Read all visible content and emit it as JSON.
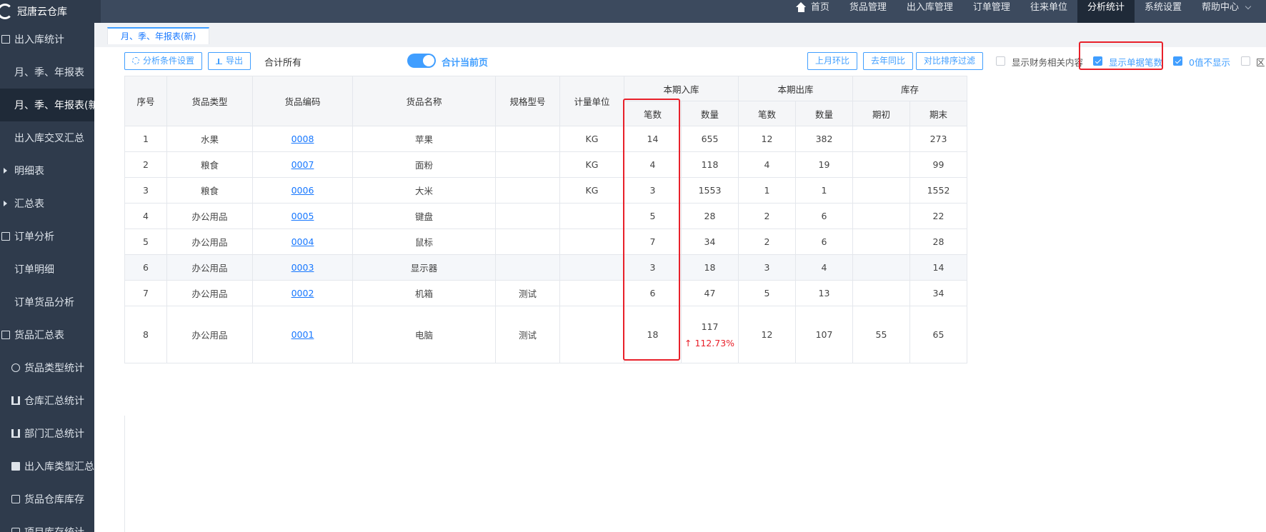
{
  "app": {
    "name": "冠唐云仓库"
  },
  "nav": {
    "items": [
      "首页",
      "货品管理",
      "出入库管理",
      "订单管理",
      "往来单位",
      "分析统计",
      "系统设置",
      "帮助中心"
    ],
    "active": "分析统计"
  },
  "sidebar": {
    "items": [
      {
        "label": "出入库统计",
        "icon": "doc-icon"
      },
      {
        "label": "月、季、年报表"
      },
      {
        "label": "月、季、年报表(新)",
        "selected": true
      },
      {
        "label": "出入库交叉汇总"
      },
      {
        "label": "明细表",
        "icon": "caret-right-icon"
      },
      {
        "label": "汇总表",
        "icon": "caret-right-icon"
      },
      {
        "label": "订单分析",
        "icon": "doc-icon"
      },
      {
        "label": "订单明细"
      },
      {
        "label": "订单货品分析"
      },
      {
        "label": "货品汇总表",
        "icon": "doc-icon"
      },
      {
        "label": "货品类型统计",
        "icon": "clock-icon"
      },
      {
        "label": "仓库汇总统计",
        "icon": "bar-chart-icon"
      },
      {
        "label": "部门汇总统计",
        "icon": "bar-chart-icon"
      },
      {
        "label": "出入库类型汇总",
        "icon": "picture-icon"
      },
      {
        "label": "货品仓库库存",
        "icon": "box-icon"
      },
      {
        "label": "项目库存统计",
        "icon": "box-icon"
      }
    ]
  },
  "tab": {
    "label": "月、季、年报表(新)"
  },
  "toolbar": {
    "settings_label": "分析条件设置",
    "export_label": "导出",
    "sum_all_label": "合计所有",
    "sum_page_label": "合计当前页",
    "mom_label": "上月环比",
    "yoy_label": "去年同比",
    "filter_label": "对比排序过滤",
    "options": [
      {
        "label": "显示财务相关内容",
        "checked": false
      },
      {
        "label": "显示单据笔数",
        "checked": true
      },
      {
        "label": "0值不显示",
        "checked": true
      },
      {
        "label": "区",
        "checked": false
      }
    ]
  },
  "table": {
    "headers": {
      "index": "序号",
      "type": "货品类型",
      "code": "货品编码",
      "name": "货品名称",
      "spec": "规格型号",
      "unit": "计量单位",
      "in_group": "本期入库",
      "out_group": "本期出库",
      "stock_group": "库存",
      "count": "笔数",
      "qty": "数量",
      "begin": "期初",
      "end": "期末"
    },
    "rows": [
      {
        "index": "1",
        "type": "水果",
        "code": "0008",
        "name": "苹果",
        "spec": "",
        "unit": "KG",
        "in_count": "14",
        "in_qty": "655",
        "in_pct": "",
        "out_count": "12",
        "out_qty": "382",
        "begin": "",
        "end": "273"
      },
      {
        "index": "2",
        "type": "粮食",
        "code": "0007",
        "name": "面粉",
        "spec": "",
        "unit": "KG",
        "in_count": "4",
        "in_qty": "118",
        "in_pct": "",
        "out_count": "4",
        "out_qty": "19",
        "begin": "",
        "end": "99"
      },
      {
        "index": "3",
        "type": "粮食",
        "code": "0006",
        "name": "大米",
        "spec": "",
        "unit": "KG",
        "in_count": "3",
        "in_qty": "1553",
        "in_pct": "",
        "out_count": "1",
        "out_qty": "1",
        "begin": "",
        "end": "1552"
      },
      {
        "index": "4",
        "type": "办公用品",
        "code": "0005",
        "name": "键盘",
        "spec": "",
        "unit": "",
        "in_count": "5",
        "in_qty": "28",
        "in_pct": "",
        "out_count": "2",
        "out_qty": "6",
        "begin": "",
        "end": "22"
      },
      {
        "index": "5",
        "type": "办公用品",
        "code": "0004",
        "name": "鼠标",
        "spec": "",
        "unit": "",
        "in_count": "7",
        "in_qty": "34",
        "in_pct": "",
        "out_count": "2",
        "out_qty": "6",
        "begin": "",
        "end": "28"
      },
      {
        "index": "6",
        "type": "办公用品",
        "code": "0003",
        "name": "显示器",
        "spec": "",
        "unit": "",
        "in_count": "3",
        "in_qty": "18",
        "in_pct": "",
        "out_count": "3",
        "out_qty": "4",
        "begin": "",
        "end": "14"
      },
      {
        "index": "7",
        "type": "办公用品",
        "code": "0002",
        "name": "机箱",
        "spec": "测试",
        "unit": "",
        "in_count": "6",
        "in_qty": "47",
        "in_pct": "",
        "out_count": "5",
        "out_qty": "13",
        "begin": "",
        "end": "34"
      },
      {
        "index": "8",
        "type": "办公用品",
        "code": "0001",
        "name": "电脑",
        "spec": "测试",
        "unit": "",
        "in_count": "18",
        "in_qty": "117",
        "in_pct": "↑ 112.73%",
        "out_count": "12",
        "out_qty": "107",
        "begin": "55",
        "end": "65"
      }
    ]
  },
  "colors": {
    "accent": "#409eff",
    "highlight": "#e8202a",
    "sidebar_bg": "#2f3b4c",
    "topbar_bg": "#3c4a5e"
  }
}
